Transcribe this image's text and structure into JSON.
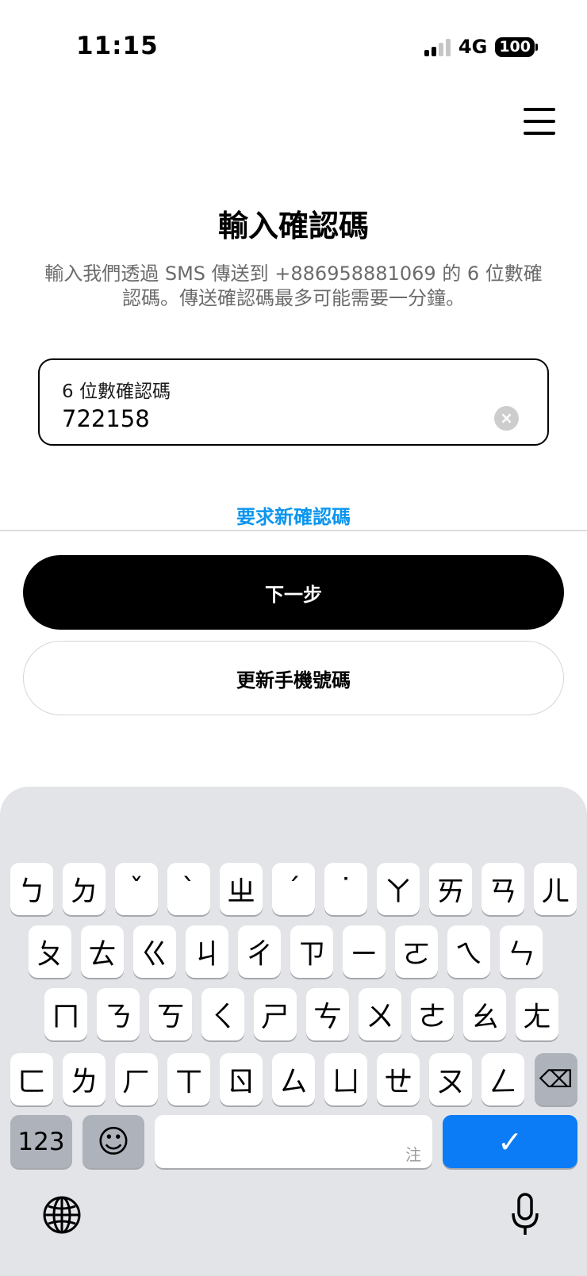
{
  "status": {
    "time": "11:15",
    "network": "4G",
    "battery": "100"
  },
  "page": {
    "title": "輸入確認碼",
    "description": "輸入我們透過 SMS 傳送到 +886958881069 的 6 位數確認碼。傳送確認碼最多可能需要一分鐘。"
  },
  "field": {
    "label": "6 位數確認碼",
    "value": "722158",
    "clear": "×"
  },
  "links": {
    "resend": "要求新確認碼"
  },
  "buttons": {
    "next": "下一步",
    "update_phone": "更新手機號碼"
  },
  "keyboard": {
    "rows": [
      [
        "ㄅ",
        "ㄉ",
        "ˇ",
        "ˋ",
        "ㄓ",
        "ˊ",
        "˙",
        "ㄚ",
        "ㄞ",
        "ㄢ",
        "ㄦ"
      ],
      [
        "ㄆ",
        "ㄊ",
        "ㄍ",
        "ㄐ",
        "ㄔ",
        "ㄗ",
        "ㄧ",
        "ㄛ",
        "ㄟ",
        "ㄣ"
      ],
      [
        "ㄇ",
        "ㄋ",
        "ㄎ",
        "ㄑ",
        "ㄕ",
        "ㄘ",
        "ㄨ",
        "ㄜ",
        "ㄠ",
        "ㄤ"
      ],
      [
        "ㄈ",
        "ㄌ",
        "ㄏ",
        "ㄒ",
        "ㄖ",
        "ㄙ",
        "ㄩ",
        "ㄝ",
        "ㄡ",
        "ㄥ"
      ]
    ],
    "backspace": "⌫",
    "numbers": "123",
    "emoji": "☺",
    "space_hint": "注",
    "confirm": "✓",
    "icons": {
      "globe": "globe-icon",
      "mic": "microphone-icon"
    }
  }
}
